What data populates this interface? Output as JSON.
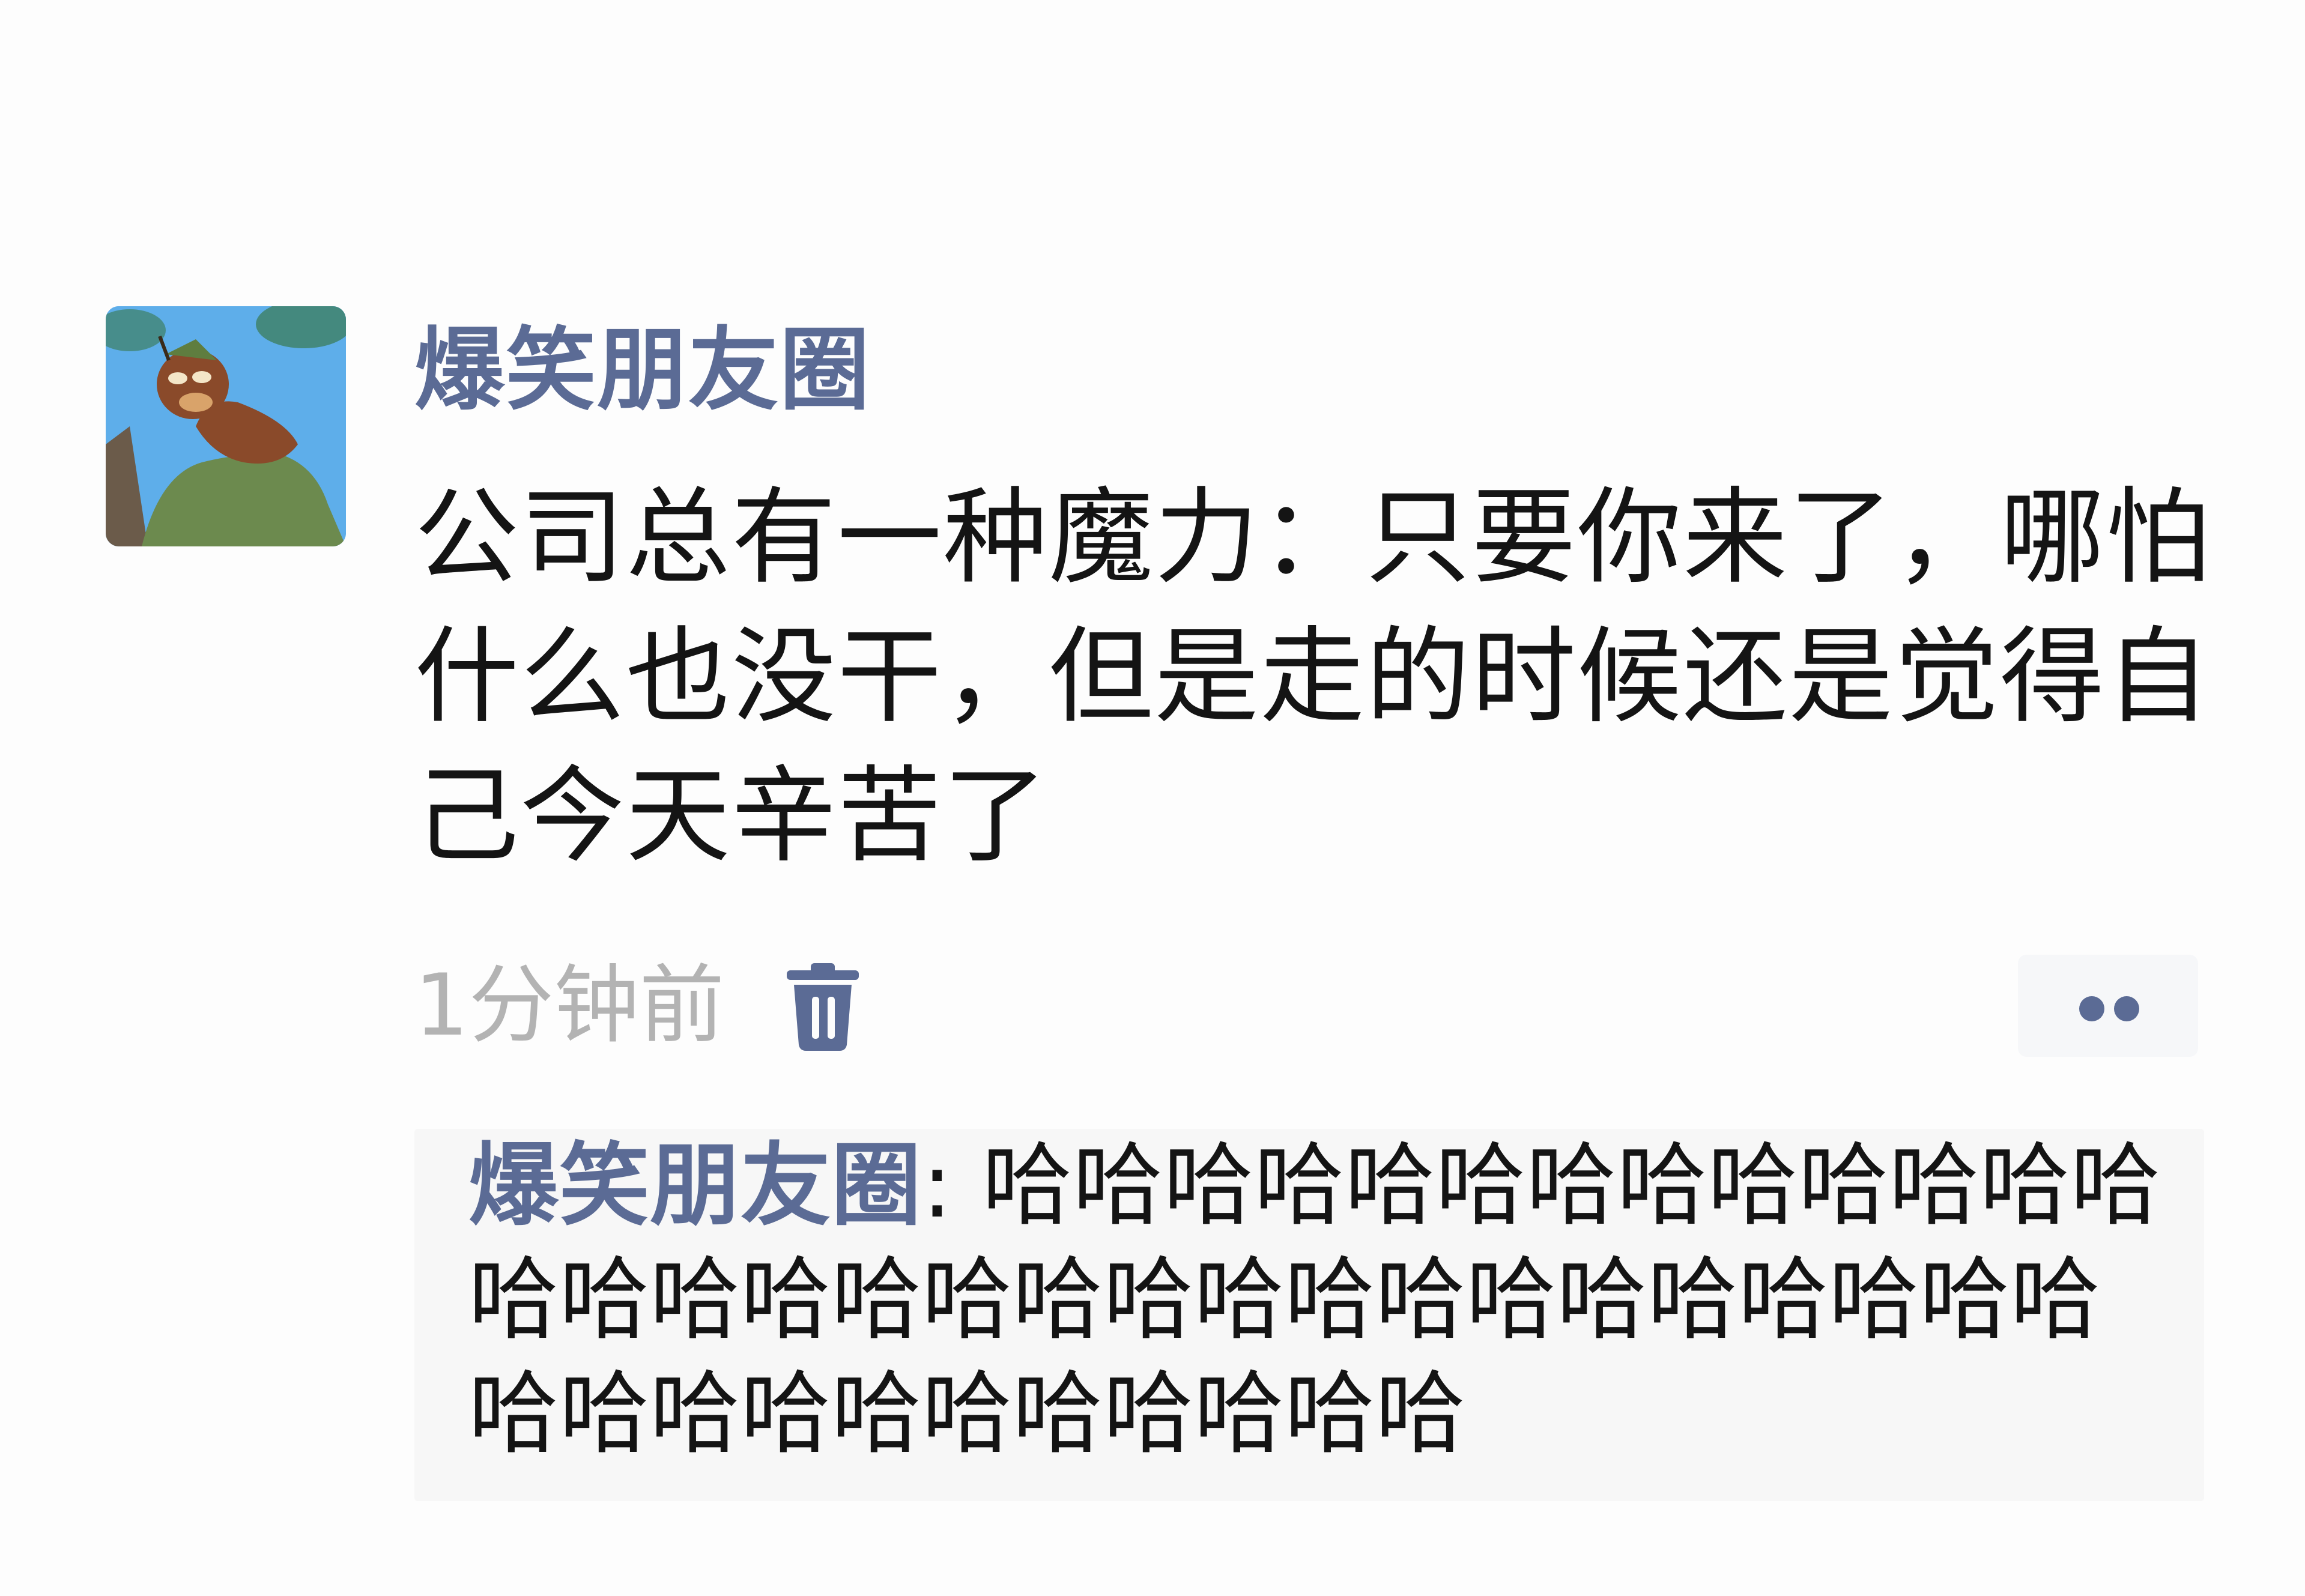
{
  "post": {
    "author": "爆笑朋友圈",
    "text": "公司总有一种魔力：只要你来了，哪怕什么也没干，但是走的时候还是觉得自己今天辛苦了",
    "timestamp": "1分钟前",
    "delete_icon": "trash-icon",
    "more_icon": "two-dots-icon"
  },
  "comment": {
    "author": "爆笑朋友圈",
    "separator": ": ",
    "text": "哈哈哈哈哈哈哈哈哈哈哈哈哈哈哈哈哈哈哈哈哈哈哈哈哈哈哈哈哈哈哈哈哈哈哈哈哈哈哈哈哈哈"
  },
  "colors": {
    "name_blue": "#5b6b95",
    "timestamp_gray": "#b3b3b3",
    "comment_bg": "#f7f7f7"
  }
}
